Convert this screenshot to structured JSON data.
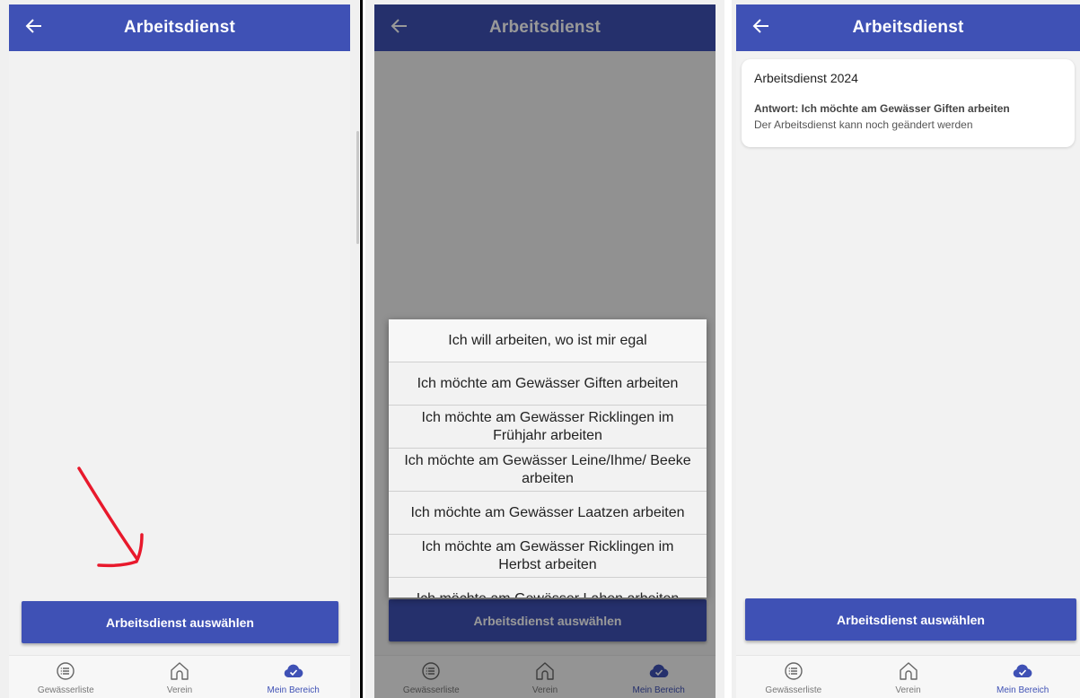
{
  "screens": [
    {
      "appbar": {
        "title": "Arbeitsdienst",
        "back_icon": "arrow-left-icon"
      },
      "primary_button": "Arbeitsdienst auswählen",
      "nav": [
        {
          "label": "Gewässerliste",
          "icon": "list-circle-icon"
        },
        {
          "label": "Verein",
          "icon": "home-icon"
        },
        {
          "label": "Mein Bereich",
          "icon": "check-cloud-icon"
        }
      ],
      "annotation_color": "#e8192c"
    },
    {
      "appbar": {
        "title": "Arbeitsdienst",
        "back_icon": "arrow-left-icon"
      },
      "primary_button": "Arbeitsdienst auswählen",
      "dialog_options": [
        "Ich will arbeiten, wo ist mir egal",
        "Ich möchte am Gewässer Giften arbeiten",
        "Ich möchte am Gewässer Ricklingen im Frühjahr arbeiten",
        "Ich möchte am Gewässer Leine/Ihme/ Beeke arbeiten",
        "Ich möchte am Gewässer Laatzen arbeiten",
        "Ich möchte am Gewässer Ricklingen im Herbst arbeiten",
        "Ich möchte am Gewässer Lahen arbeiten"
      ],
      "nav": [
        {
          "label": "Gewässerliste",
          "icon": "list-circle-icon"
        },
        {
          "label": "Verein",
          "icon": "home-icon"
        },
        {
          "label": "Mein Bereich",
          "icon": "check-cloud-icon"
        }
      ]
    },
    {
      "appbar": {
        "title": "Arbeitsdienst",
        "back_icon": "arrow-left-icon"
      },
      "card": {
        "title": "Arbeitsdienst 2024",
        "answer": "Antwort: Ich möchte am Gewässer Giften arbeiten",
        "note": "Der Arbeitsdienst kann noch geändert werden"
      },
      "primary_button": "Arbeitsdienst auswählen",
      "nav": [
        {
          "label": "Gewässerliste",
          "icon": "list-circle-icon"
        },
        {
          "label": "Verein",
          "icon": "home-icon"
        },
        {
          "label": "Mein Bereich",
          "icon": "check-cloud-icon"
        }
      ]
    }
  ],
  "colors": {
    "primary": "#3f51b5",
    "background": "#f2f2f2",
    "nav_active": "#3f51b5",
    "nav_inactive": "#777777"
  }
}
